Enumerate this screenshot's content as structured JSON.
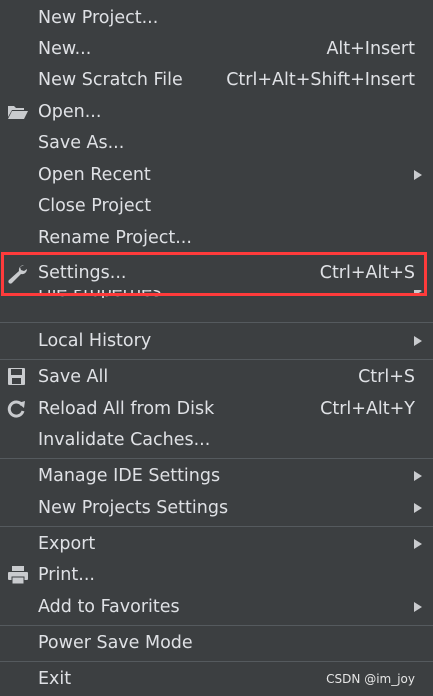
{
  "colors": {
    "background": "#3c3f41",
    "text": "#dfe1e5",
    "separator": "#555a5e",
    "highlight_box": "#ff3b3b"
  },
  "menu": {
    "new_project": "New Project...",
    "new": "New...",
    "new_shortcut": "Alt+Insert",
    "new_scratch": "New Scratch File",
    "new_scratch_shortcut": "Ctrl+Alt+Shift+Insert",
    "open": "Open...",
    "save_as": "Save As...",
    "open_recent": "Open Recent",
    "close_project": "Close Project",
    "rename_project": "Rename Project...",
    "settings": "Settings...",
    "settings_shortcut": "Ctrl+Alt+S",
    "file_properties": "File Properties",
    "local_history": "Local History",
    "save_all": "Save All",
    "save_all_shortcut": "Ctrl+S",
    "reload_all": "Reload All from Disk",
    "reload_all_shortcut": "Ctrl+Alt+Y",
    "invalidate_caches": "Invalidate Caches...",
    "manage_ide_settings": "Manage IDE Settings",
    "new_projects_settings": "New Projects Settings",
    "export": "Export",
    "print": "Print...",
    "add_to_favorites": "Add to Favorites",
    "power_save_mode": "Power Save Mode",
    "exit": "Exit"
  },
  "icons": {
    "open": "folder-open-icon",
    "settings": "wrench-icon",
    "save_all": "floppy-disk-icon",
    "reload_all": "refresh-icon",
    "print": "printer-icon"
  },
  "watermark": "CSDN @im_joy"
}
